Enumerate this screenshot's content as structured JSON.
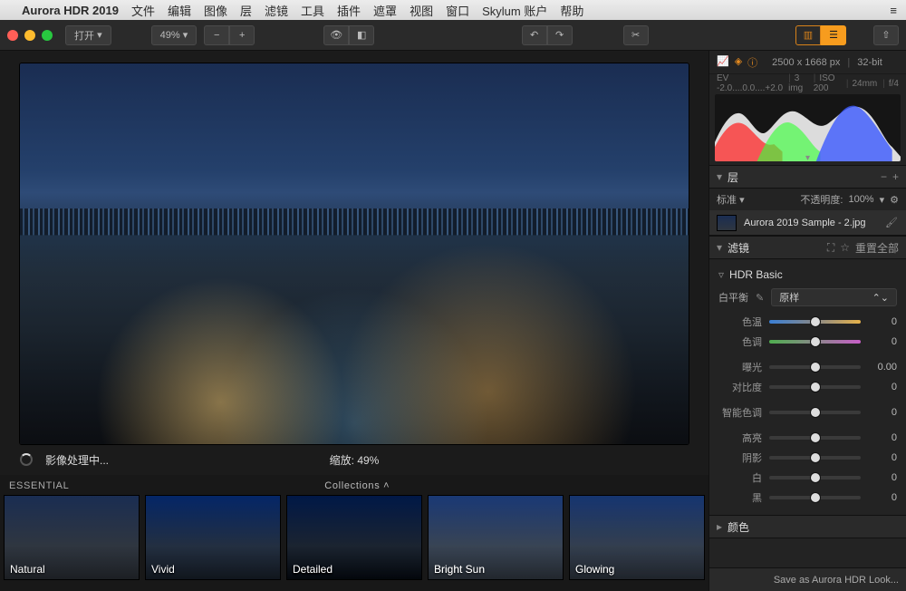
{
  "menubar": {
    "app": "Aurora HDR 2019",
    "items": [
      "文件",
      "编辑",
      "图像",
      "层",
      "滤镜",
      "工具",
      "插件",
      "遮罩",
      "视图",
      "窗口",
      "Skylum 账户",
      "帮助"
    ]
  },
  "toolbar": {
    "open": "打开",
    "zoom": "49%"
  },
  "status": {
    "processing": "影像处理中...",
    "zoom_label": "缩放: 49%"
  },
  "strip": {
    "category": "ESSENTIAL",
    "collections": "Collections",
    "presets": [
      "Natural",
      "Vivid",
      "Detailed",
      "Bright Sun",
      "Glowing"
    ]
  },
  "info": {
    "dimensions": "2500 x 1668 px",
    "depth": "32-bit",
    "ev": "EV  -2.0....0.0....+2.0",
    "imgs": "3 img",
    "iso": "ISO 200",
    "focal": "24mm",
    "aperture": "f/4"
  },
  "layers": {
    "header": "层",
    "blend_label": "标准",
    "opacity_label": "不透明度:",
    "opacity_value": "100%",
    "layer_name": "Aurora 2019 Sample - 2.jpg"
  },
  "filters": {
    "header": "滤镜",
    "reset": "重置全部",
    "group": "HDR Basic",
    "wb_label": "白平衡",
    "wb_value": "原样",
    "sliders": [
      {
        "label": "色温",
        "value": "0",
        "cls": "temp"
      },
      {
        "label": "色调",
        "value": "0",
        "cls": "tint"
      },
      {
        "label": "曝光",
        "value": "0.00",
        "cls": ""
      },
      {
        "label": "对比度",
        "value": "0",
        "cls": ""
      },
      {
        "label": "智能色调",
        "value": "0",
        "cls": ""
      },
      {
        "label": "高亮",
        "value": "0",
        "cls": ""
      },
      {
        "label": "阴影",
        "value": "0",
        "cls": ""
      },
      {
        "label": "白",
        "value": "0",
        "cls": ""
      },
      {
        "label": "黑",
        "value": "0",
        "cls": ""
      }
    ],
    "next_group": "颜色"
  },
  "savebar": "Save as Aurora HDR Look..."
}
